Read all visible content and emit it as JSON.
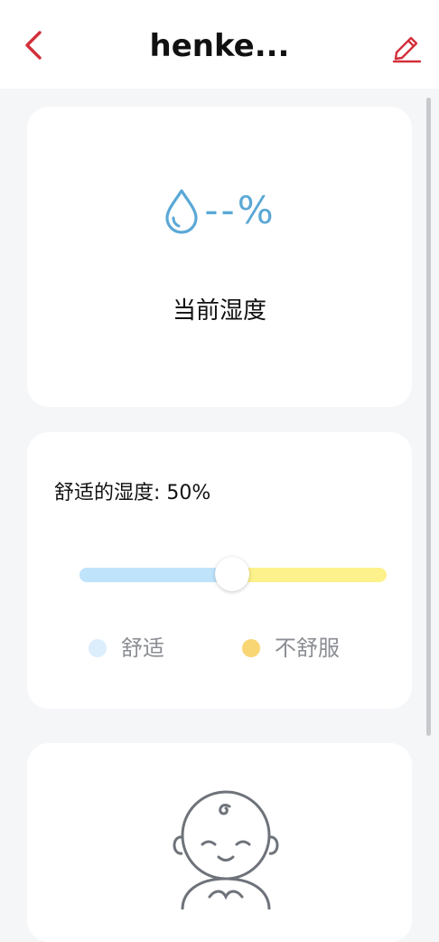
{
  "header": {
    "title": "henke...",
    "back_icon": "chevron-left-icon",
    "edit_icon": "edit-pencil-icon",
    "accent_color": "#d32f3a"
  },
  "humidity_card": {
    "icon": "water-drop-icon",
    "value": "--%",
    "label": "当前湿度",
    "icon_color": "#5aa8d6"
  },
  "comfort_card": {
    "title": "舒适的湿度: 50%",
    "slider_value_percent": 50,
    "comfortable_color": "#bfe3fb",
    "uncomfortable_color": "#fdf18c",
    "legend": [
      {
        "label": "舒适",
        "color": "#dcedfc"
      },
      {
        "label": "不舒服",
        "color": "#f9d674"
      }
    ]
  },
  "baby_card": {
    "illustration": "baby-face-illustration"
  }
}
